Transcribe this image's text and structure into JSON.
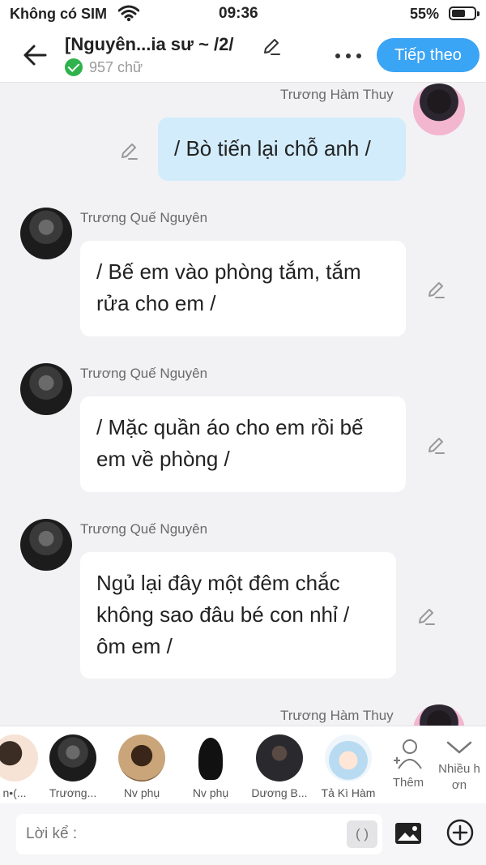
{
  "status_bar": {
    "carrier": "Không có SIM",
    "time": "09:36",
    "battery": "55%"
  },
  "header": {
    "title": "[Nguyên...ia sư ~ /2/",
    "word_count": "957 chữ",
    "next_button": "Tiếp theo"
  },
  "messages": [
    {
      "sender": "Trương Hàm Thuy",
      "text": "/ Bò tiến lại chỗ anh /",
      "mine": true
    },
    {
      "sender": "Trương Quế Nguyên",
      "lines": [
        "/ Bế em vào phòng tắm, tắm",
        "rửa cho em /"
      ]
    },
    {
      "sender": "Trương Quế Nguyên",
      "lines": [
        "/ Mặc quần áo cho em rồi bế",
        "em về phòng /"
      ]
    },
    {
      "sender": "Trương Quế Nguyên",
      "lines": [
        "Ngủ lại đây một đêm chắc",
        "không sao đâu bé con nhỉ /",
        "ôm em /"
      ]
    },
    {
      "sender": "Trương Hàm Thuy",
      "mine": true
    }
  ],
  "characters": [
    {
      "name": "n•(..."
    },
    {
      "name": "Trương..."
    },
    {
      "name": "Nv phụ"
    },
    {
      "name": "Nv phụ"
    },
    {
      "name": "Dương B..."
    },
    {
      "name": "Tả Kì Hàm"
    }
  ],
  "char_actions": {
    "add_label": "Thêm",
    "more_label_1": "Nhiều h",
    "more_label_2": "ơn"
  },
  "input": {
    "placeholder": "Lời kể :",
    "paren": "( )"
  },
  "colors": {
    "accent": "#3aa4f5",
    "my_bubble": "#d2ecfb",
    "check": "#2fb24c"
  }
}
